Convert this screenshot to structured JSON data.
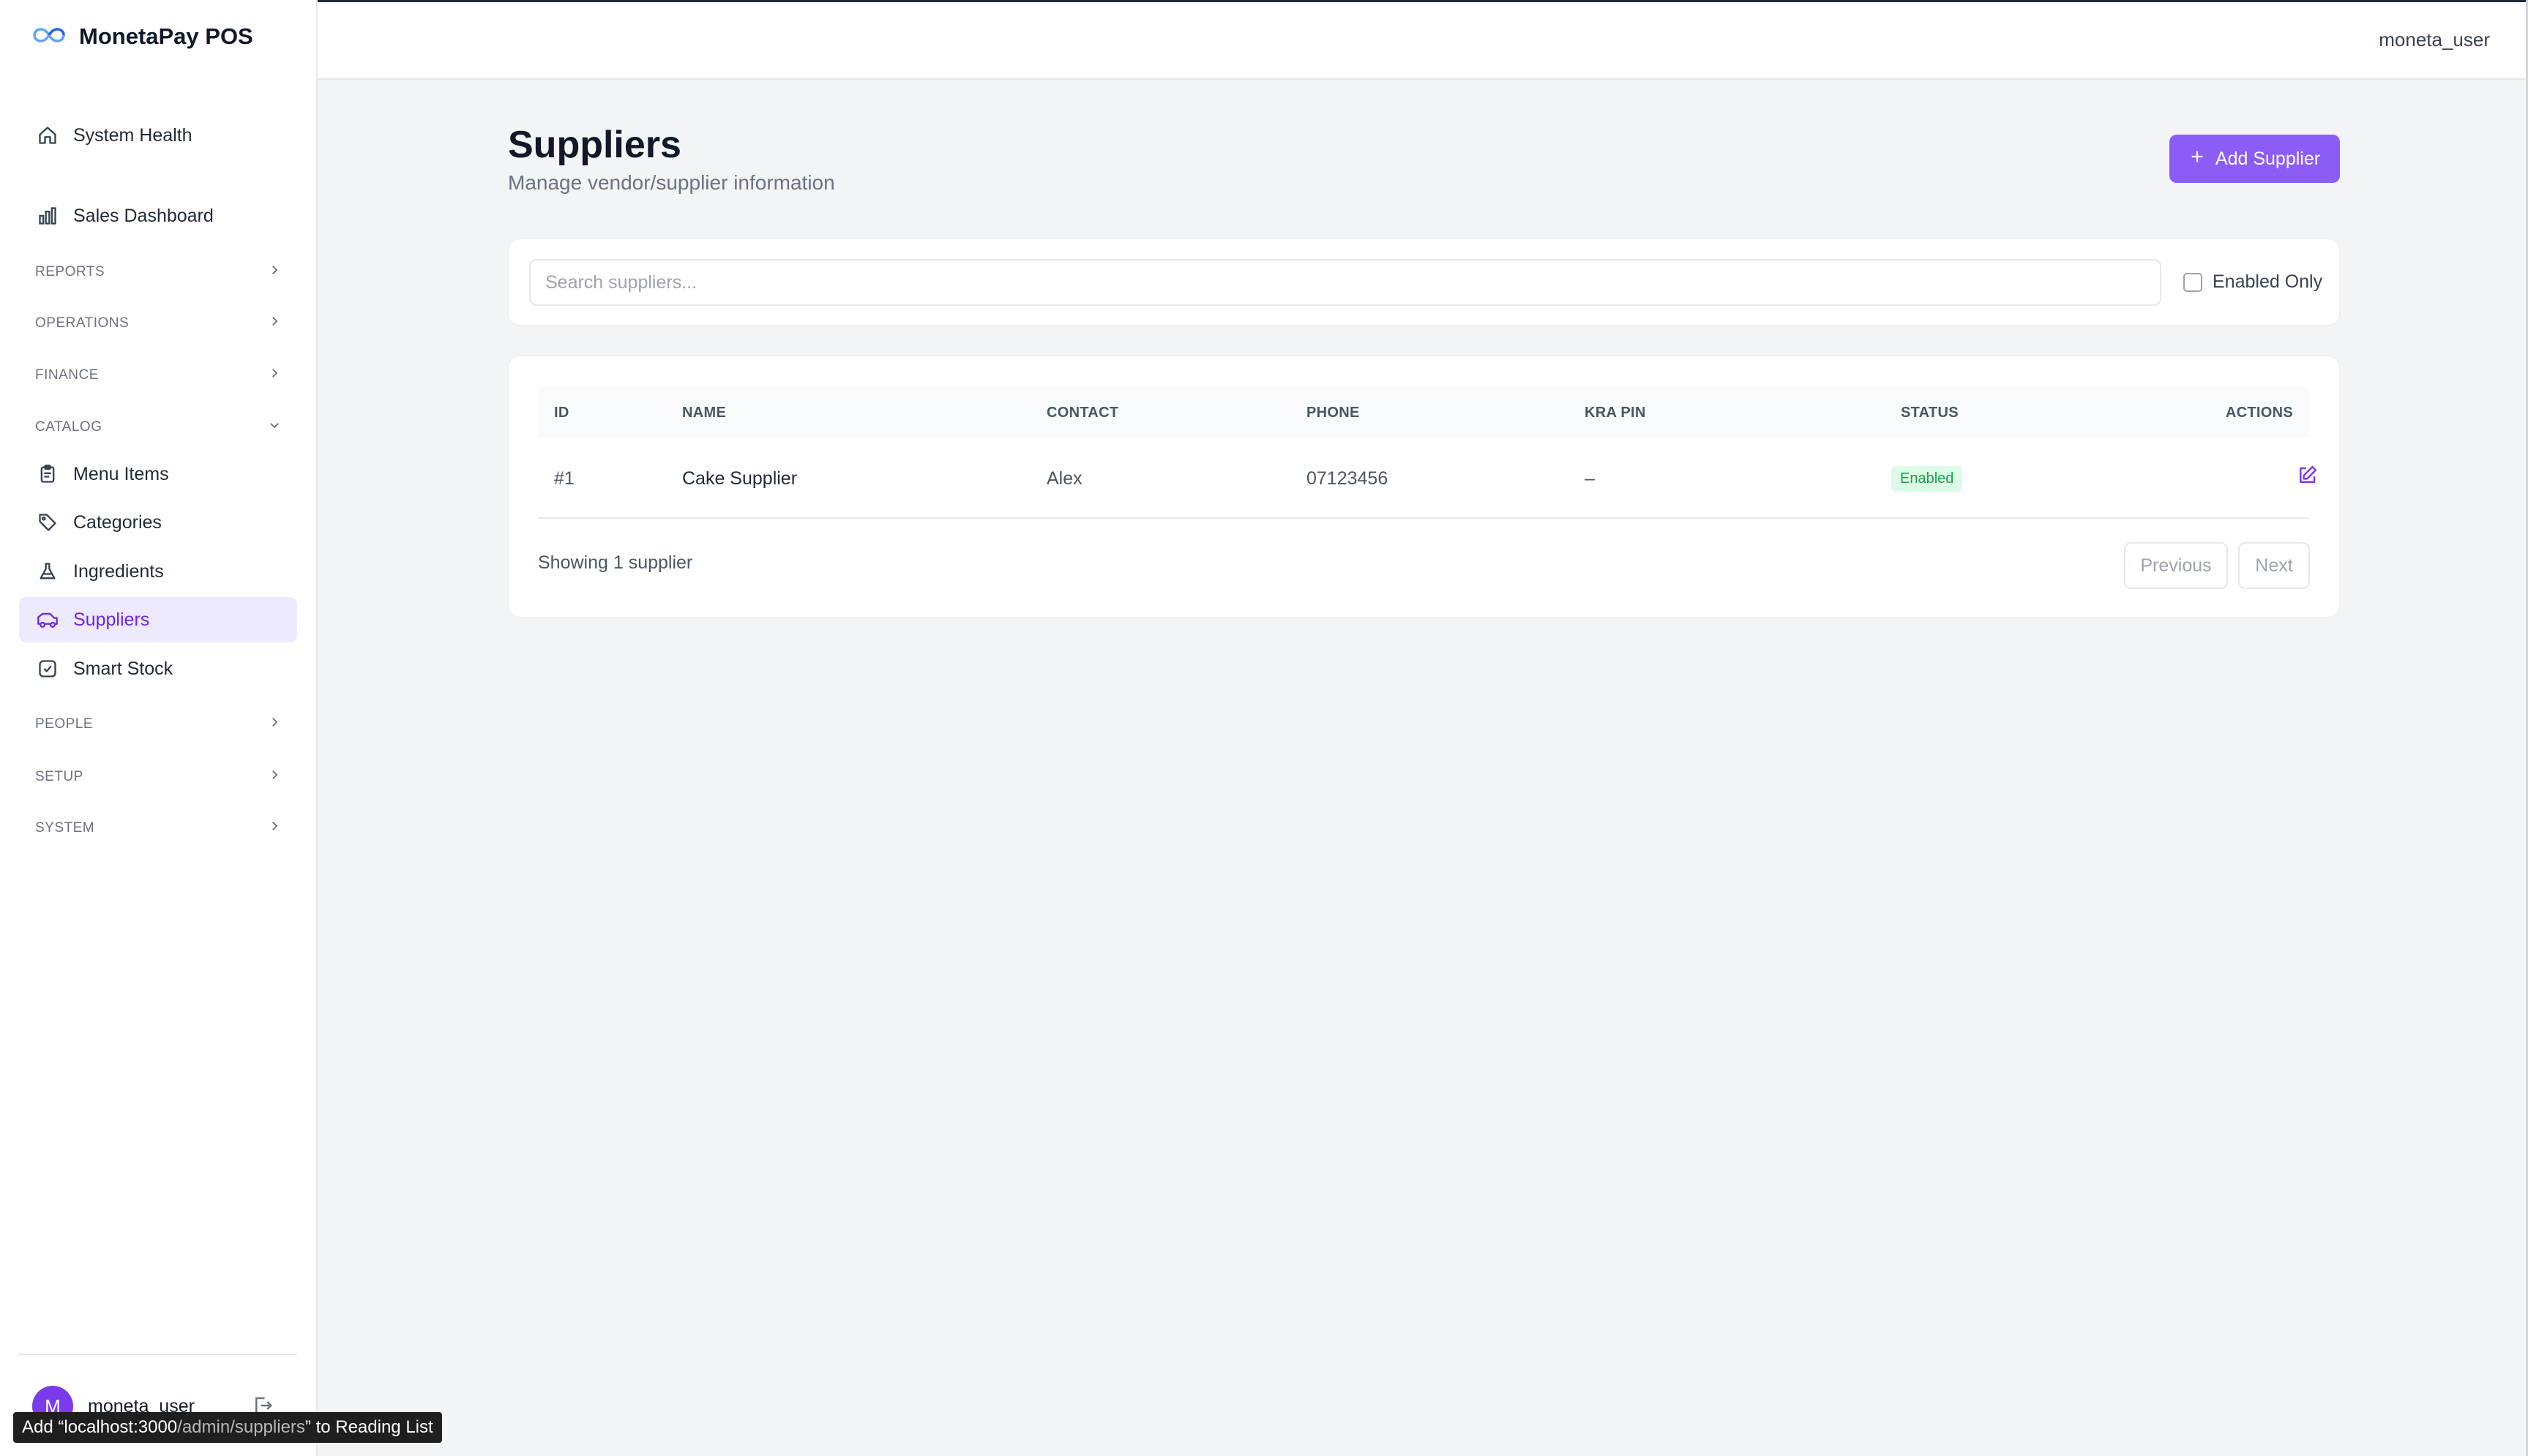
{
  "app": {
    "title": "MonetaPay POS"
  },
  "header": {
    "username": "moneta_user"
  },
  "sidebar": {
    "top_items": [
      {
        "label": "System Health",
        "icon": "home-icon"
      },
      {
        "label": "Sales Dashboard",
        "icon": "bar-chart-icon"
      }
    ],
    "sections": {
      "reports": "REPORTS",
      "operations": "OPERATIONS",
      "finance": "FINANCE",
      "catalog": "CATALOG",
      "people": "PEOPLE",
      "setup": "SETUP",
      "system": "SYSTEM"
    },
    "catalog_items": [
      {
        "label": "Menu Items",
        "icon": "clipboard-icon"
      },
      {
        "label": "Categories",
        "icon": "tag-icon"
      },
      {
        "label": "Ingredients",
        "icon": "flask-icon"
      },
      {
        "label": "Suppliers",
        "icon": "truck-icon",
        "active": true
      },
      {
        "label": "Smart Stock",
        "icon": "stock-check-icon"
      }
    ],
    "footer": {
      "avatar_initial": "M",
      "username": "moneta_user"
    }
  },
  "page": {
    "title": "Suppliers",
    "subtitle": "Manage vendor/supplier information",
    "add_button": "Add Supplier"
  },
  "filters": {
    "search_placeholder": "Search suppliers...",
    "search_value": "",
    "enabled_only_label": "Enabled Only",
    "enabled_only_checked": false
  },
  "table": {
    "columns": [
      "ID",
      "NAME",
      "CONTACT",
      "PHONE",
      "KRA PIN",
      "STATUS",
      "ACTIONS"
    ],
    "rows": [
      {
        "id": "#1",
        "name": "Cake Supplier",
        "contact": "Alex",
        "phone": "07123456",
        "kra_pin": "–",
        "status": "Enabled"
      }
    ],
    "footer_text": "Showing 1 supplier",
    "prev_label": "Previous",
    "next_label": "Next"
  },
  "tooltip": {
    "prefix": "Add “localhost:3000",
    "path": "/admin/suppliers",
    "suffix": "” to Reading List"
  },
  "colors": {
    "accent": "#8b5cf6",
    "active_bg": "#ede9fe",
    "active_text": "#6d28d9",
    "status_bg": "#dcfce7",
    "status_text": "#16a34a",
    "page_bg": "#f3f4f6"
  }
}
